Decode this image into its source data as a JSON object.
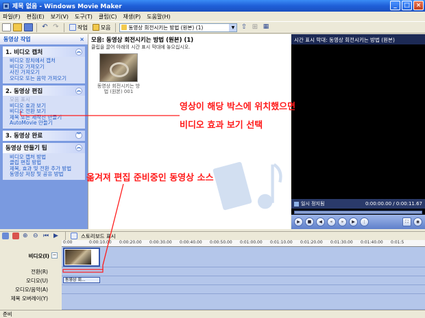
{
  "window": {
    "title": "제목 없음 - Windows Movie Maker"
  },
  "menu": [
    "파일(F)",
    "편집(E)",
    "보기(V)",
    "도구(T)",
    "클립(C)",
    "재생(P)",
    "도움말(H)"
  ],
  "toolbar": {
    "tasks_label": "작업",
    "collections_label": "모음",
    "collection_combo": "동영상 회전시키는 방법 (원본) (1)"
  },
  "taskpane": {
    "header": "동영상 작업",
    "close": "×",
    "sections": [
      {
        "title": "1. 비디오 캡처",
        "links": [
          "비디오 장치에서 캡처",
          "비디오 가져오기",
          "사진 가져오기",
          "오디오 또는 음악 가져오기"
        ]
      },
      {
        "title": "2. 동영상 편집",
        "links": [
          "모음 표시",
          "비디오 효과 보기",
          "비디오 전환 보기",
          "제목 또는 제작진 만들기",
          "AutoMovie 만들기"
        ]
      },
      {
        "title": "3. 동영상 완료",
        "links": []
      },
      {
        "title": "동영상 만들기 팁",
        "links": [
          "비디오 캡처 방법",
          "클립 편집 방법",
          "제목, 효과 및 전환 추가 방법",
          "동영상 저장 및 공유 방법"
        ]
      }
    ]
  },
  "collection": {
    "title": "모음: 동영상 회전시키는 방법 (원본) (1)",
    "subtitle": "클립을 끌어 아래의 시간 표시 막대에 놓으십시오.",
    "clip_label": "동영상 회전시키는 방법 (원본) 001"
  },
  "preview": {
    "title": "시간 표시 막대: 동영상 회전시키는 방법 (원본)",
    "state": "일시 정지됨",
    "time": "0:00:00.00 / 0:00:11.67"
  },
  "timeline": {
    "toolbar_label": "스토리보드 표시",
    "ticks": [
      "0:00",
      "0:00:10.00",
      "0:00:20.00",
      "0:00:30.00",
      "0:00:40.00",
      "0:00:50.00",
      "0:01:00.00",
      "0:01:10.00",
      "0:01:20.00",
      "0:01:30.00",
      "0:01:40.00",
      "0:01:5"
    ],
    "tracks": {
      "video": "비디오(I)",
      "transition": "전환(R)",
      "audio": "오디오(U)",
      "audio_music": "오디오/음악(A)",
      "title_overlay": "제목 오버레이(Y)"
    },
    "audio_clip_label": "동영상 회..."
  },
  "status": "준비",
  "annotations": {
    "line1": "영상이 해당 박스에 위치했으면",
    "line2": "비디오 효과 보기 선택",
    "line3": "옮겨져 편집 준비중인 동영상 소스"
  },
  "colors": {
    "annotation": "#ff1a1a",
    "accent": "#215dc6"
  }
}
